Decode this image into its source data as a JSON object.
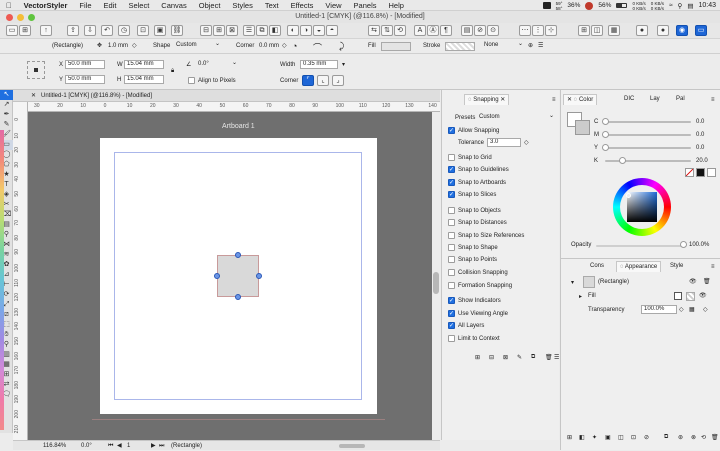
{
  "menubar": {
    "apple_icon": "apple-icon",
    "app_name": "VectorStyler",
    "items": [
      "File",
      "Edit",
      "Select",
      "Canvas",
      "Object",
      "Styles",
      "Text",
      "Effects",
      "View",
      "Panels",
      "Help"
    ],
    "tray": {
      "temp_top": "59°",
      "temp_bottom": "58°",
      "cpu": "36%",
      "battery": "56%",
      "net_up": "0 KB/s",
      "net_down": "0 KB/s",
      "net2_up": "0 KB/s",
      "net2_down": "0 KB/s",
      "clock": "10:43"
    }
  },
  "window": {
    "title": "Untitled-1 [CMYK] (@116.8%) - [Modified]"
  },
  "object_bar": {
    "object_type": "(Rectangle)",
    "stroke_width": "1.0 mm",
    "shape_label": "Shape",
    "shape_value": "Custom",
    "corner_label": "Corner",
    "corner_value": "0.0 mm",
    "fill_label": "Fill",
    "stroke_label": "Stroke",
    "stroke_value": "None"
  },
  "transform_bar": {
    "x_label": "X",
    "x_value": "50.0 mm",
    "y_label": "Y",
    "y_value": "50.0 mm",
    "w_label": "W",
    "w_value": "15.04 mm",
    "h_label": "H",
    "h_value": "15.04 mm",
    "angle_value": "0.0°",
    "align_pixels": "Align to Pixels",
    "width_label": "Width",
    "width_value": "0.35 mm",
    "corner_label": "Corner"
  },
  "document": {
    "tab_title": "Untitled-1 [CMYK] (@116.8%) - [Modified]",
    "artboard_label": "Artboard 1",
    "ruler_h": [
      "30",
      "20",
      "10",
      "0",
      "10",
      "20",
      "30",
      "40",
      "50",
      "60",
      "70",
      "80",
      "90",
      "100",
      "110",
      "120",
      "130",
      "140"
    ],
    "ruler_v": [
      "0",
      "10",
      "20",
      "30",
      "40",
      "50",
      "60",
      "70",
      "80",
      "90",
      "100",
      "110",
      "120",
      "130",
      "140",
      "150",
      "160",
      "170",
      "180",
      "190",
      "200",
      "210"
    ]
  },
  "status_bar": {
    "zoom": "116.84%",
    "angle": "0.0°",
    "page": "1",
    "object": "(Rectangle)"
  },
  "snapping_panel": {
    "tab": "Snapping",
    "presets_label": "Presets",
    "presets_value": "Custom",
    "allow_snapping": "Allow Snapping",
    "tolerance_label": "Tolerance",
    "tolerance_value": "3.0",
    "options": [
      {
        "label": "Snap to Grid",
        "checked": false
      },
      {
        "label": "Snap to Guidelines",
        "checked": true
      },
      {
        "label": "Snap to Artboards",
        "checked": true
      },
      {
        "label": "Snap to Slices",
        "checked": true
      },
      {
        "label": "Snap to Objects",
        "checked": false
      },
      {
        "label": "Snap to Distances",
        "checked": false
      },
      {
        "label": "Snap to Size References",
        "checked": false
      },
      {
        "label": "Snap to Shape",
        "checked": false
      },
      {
        "label": "Snap to Points",
        "checked": false
      },
      {
        "label": "Collision Snapping",
        "checked": false
      },
      {
        "label": "Formation Snapping",
        "checked": false
      },
      {
        "label": "Show Indicators",
        "checked": true
      },
      {
        "label": "Use Viewing Angle",
        "checked": true
      },
      {
        "label": "All Layers",
        "checked": true
      },
      {
        "label": "Limit to Context",
        "checked": false
      }
    ]
  },
  "color_panel": {
    "tabs": [
      "Color",
      "DIC",
      "Lay",
      "Pal"
    ],
    "channels": [
      {
        "label": "C",
        "value": "0.0",
        "fraction": 0.0,
        "color": "#2aa7e0"
      },
      {
        "label": "M",
        "value": "0.0",
        "fraction": 0.0,
        "color": "#d23f8f"
      },
      {
        "label": "Y",
        "value": "0.0",
        "fraction": 0.0,
        "color": "#e9d22f"
      },
      {
        "label": "K",
        "value": "20.0",
        "fraction": 0.2,
        "color": "#333333"
      }
    ],
    "opacity_label": "Opacity",
    "opacity_value": "100.0%",
    "opacity_fraction": 1.0
  },
  "appearance_panel": {
    "tabs": [
      "Cons",
      "Appearance",
      "Style"
    ],
    "object": "(Rectangle)",
    "fill_label": "Fill",
    "transparency_label": "Transparency",
    "transparency_value": "100.0%"
  },
  "colors": {
    "accent": "#1f6fe0",
    "canvas_bg": "#6f6f6f",
    "artboard": "#ffffff",
    "rect_fill": "#d9d9d9",
    "handle": "#6b96e6"
  }
}
